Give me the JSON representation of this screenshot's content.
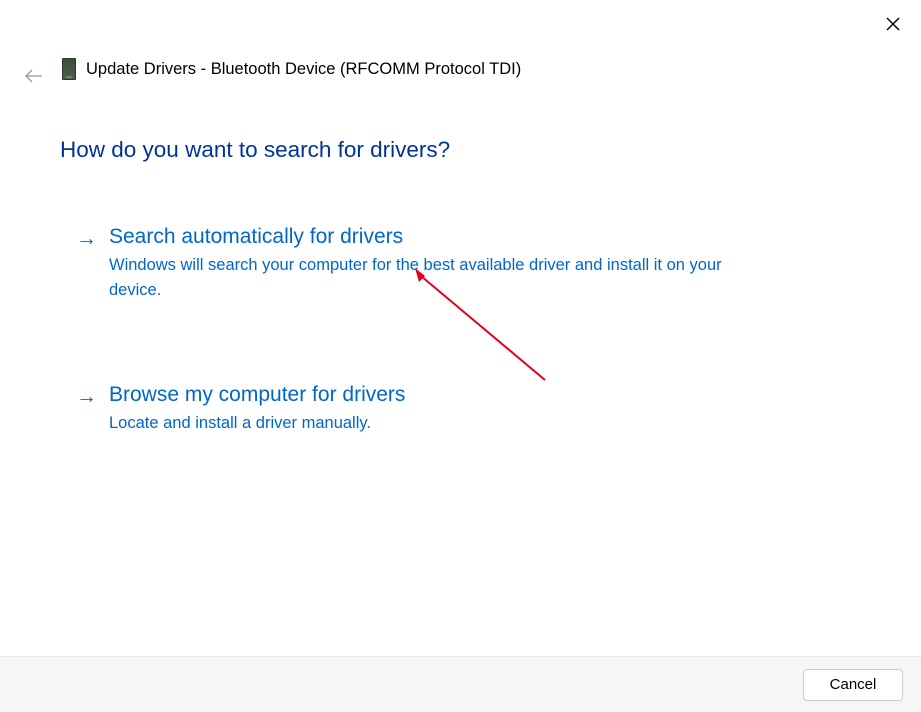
{
  "header": {
    "title": "Update Drivers - Bluetooth Device (RFCOMM Protocol TDI)"
  },
  "main_heading": "How do you want to search for drivers?",
  "options": [
    {
      "title": "Search automatically for drivers",
      "description": "Windows will search your computer for the best available driver and install it on your device."
    },
    {
      "title": "Browse my computer for drivers",
      "description": "Locate and install a driver manually."
    }
  ],
  "footer": {
    "cancel_label": "Cancel"
  }
}
